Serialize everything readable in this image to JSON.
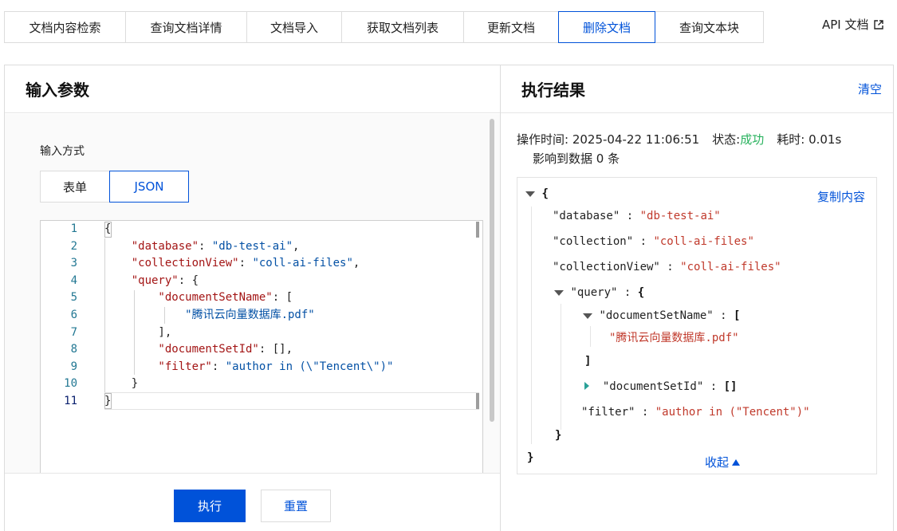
{
  "tabs": [
    {
      "label": "文档内容检索",
      "active": false
    },
    {
      "label": "查询文档详情",
      "active": false
    },
    {
      "label": "文档导入",
      "active": false
    },
    {
      "label": "获取文档列表",
      "active": false
    },
    {
      "label": "更新文档",
      "active": false
    },
    {
      "label": "删除文档",
      "active": true
    },
    {
      "label": "查询文本块",
      "active": false
    }
  ],
  "api_doc_label": "API 文档",
  "left": {
    "title": "输入参数",
    "input_mode_label": "输入方式",
    "mode_form": "表单",
    "mode_json": "JSON",
    "selected_mode": "JSON",
    "code_lines": [
      "{",
      "    \"database\": \"db-test-ai\",",
      "    \"collectionView\": \"coll-ai-files\",",
      "    \"query\": {",
      "        \"documentSetName\": [",
      "            \"腾讯云向量数据库.pdf\"",
      "        ],",
      "        \"documentSetId\": [],",
      "        \"filter\": \"author in (\\\"Tencent\\\")\"",
      "    }",
      "}"
    ],
    "line_numbers": [
      "1",
      "2",
      "3",
      "4",
      "5",
      "6",
      "7",
      "8",
      "9",
      "10",
      "11"
    ],
    "execute_label": "执行",
    "reset_label": "重置"
  },
  "right": {
    "title": "执行结果",
    "clear_label": "清空",
    "op_time_label": "操作时间:",
    "op_time": "2025-04-22 11:06:51",
    "status_label": "状态:",
    "status": "成功",
    "elapsed_label": "耗时:",
    "elapsed": "0.01s",
    "affected": "影响到数据 0 条",
    "copy_label": "复制内容",
    "collapse_label": "收起",
    "json_view": {
      "database_key": "\"database\"",
      "database_val": "\"db-test-ai\"",
      "collection_key": "\"collection\"",
      "collection_val": "\"coll-ai-files\"",
      "collectionView_key": "\"collectionView\"",
      "collectionView_val": "\"coll-ai-files\"",
      "query_key": "\"query\"",
      "documentSetName_key": "\"documentSetName\"",
      "documentSetName_val": "\"腾讯云向量数据库.pdf\"",
      "documentSetId_key": "\"documentSetId\"",
      "documentSetId_val": "[]",
      "filter_key": "\"filter\"",
      "filter_val": "\"author in (\"Tencent\")\""
    }
  },
  "colors": {
    "accent": "#0052d9",
    "success": "#29b25e",
    "json_value": "#c0392b"
  }
}
